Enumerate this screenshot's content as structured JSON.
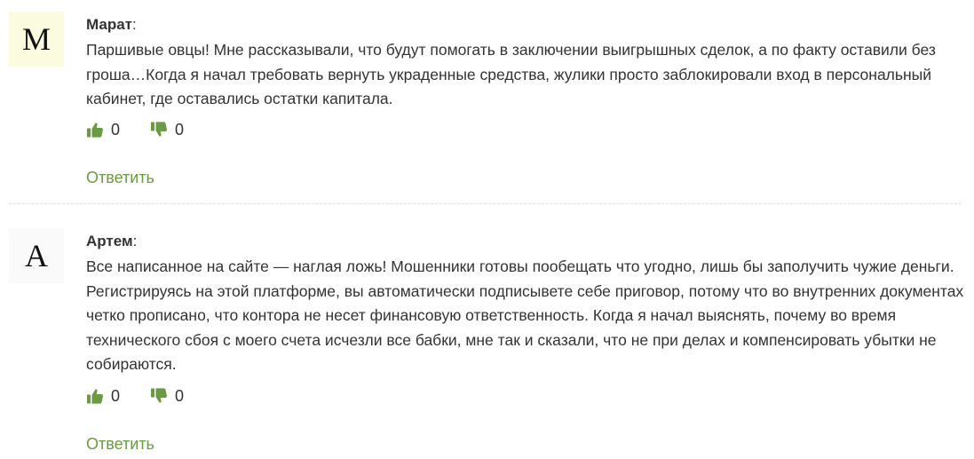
{
  "comments": [
    {
      "avatar_letter": "M",
      "author": "Марат",
      "separator": ":",
      "text": "Паршивые овцы! Мне рассказывали, что будут помогать в заключении выигрышных сделок, а по факту оставили без гроша…Когда я начал требовать вернуть украденные средства, жулики просто заблокировали вход в персональный кабинет, где оставались остатки капитала.",
      "likes": "0",
      "dislikes": "0",
      "reply_label": "Ответить"
    },
    {
      "avatar_letter": "A",
      "author": "Артем",
      "separator": ":",
      "text": "Все написанное на сайте — наглая ложь! Мошенники готовы пообещать что угодно, лишь бы заполучить чужие деньги. Регистрируясь на этой платформе, вы автоматически подписывете себе приговор, потому что во внутренних документах четко прописано, что контора не несет финансовую ответственность. Когда я начал выяснять, почему во время технического сбоя с моего счета исчезли все бабки, мне так и сказали, что не при делах и компенсировать убытки не собираются.",
      "likes": "0",
      "dislikes": "0",
      "reply_label": "Ответить"
    }
  ],
  "colors": {
    "icon_green": "#6b9a45",
    "reply_link": "#6b9a45",
    "text": "#333333"
  },
  "icons": {
    "like": "thumbs-up-icon",
    "dislike": "thumbs-down-icon"
  }
}
